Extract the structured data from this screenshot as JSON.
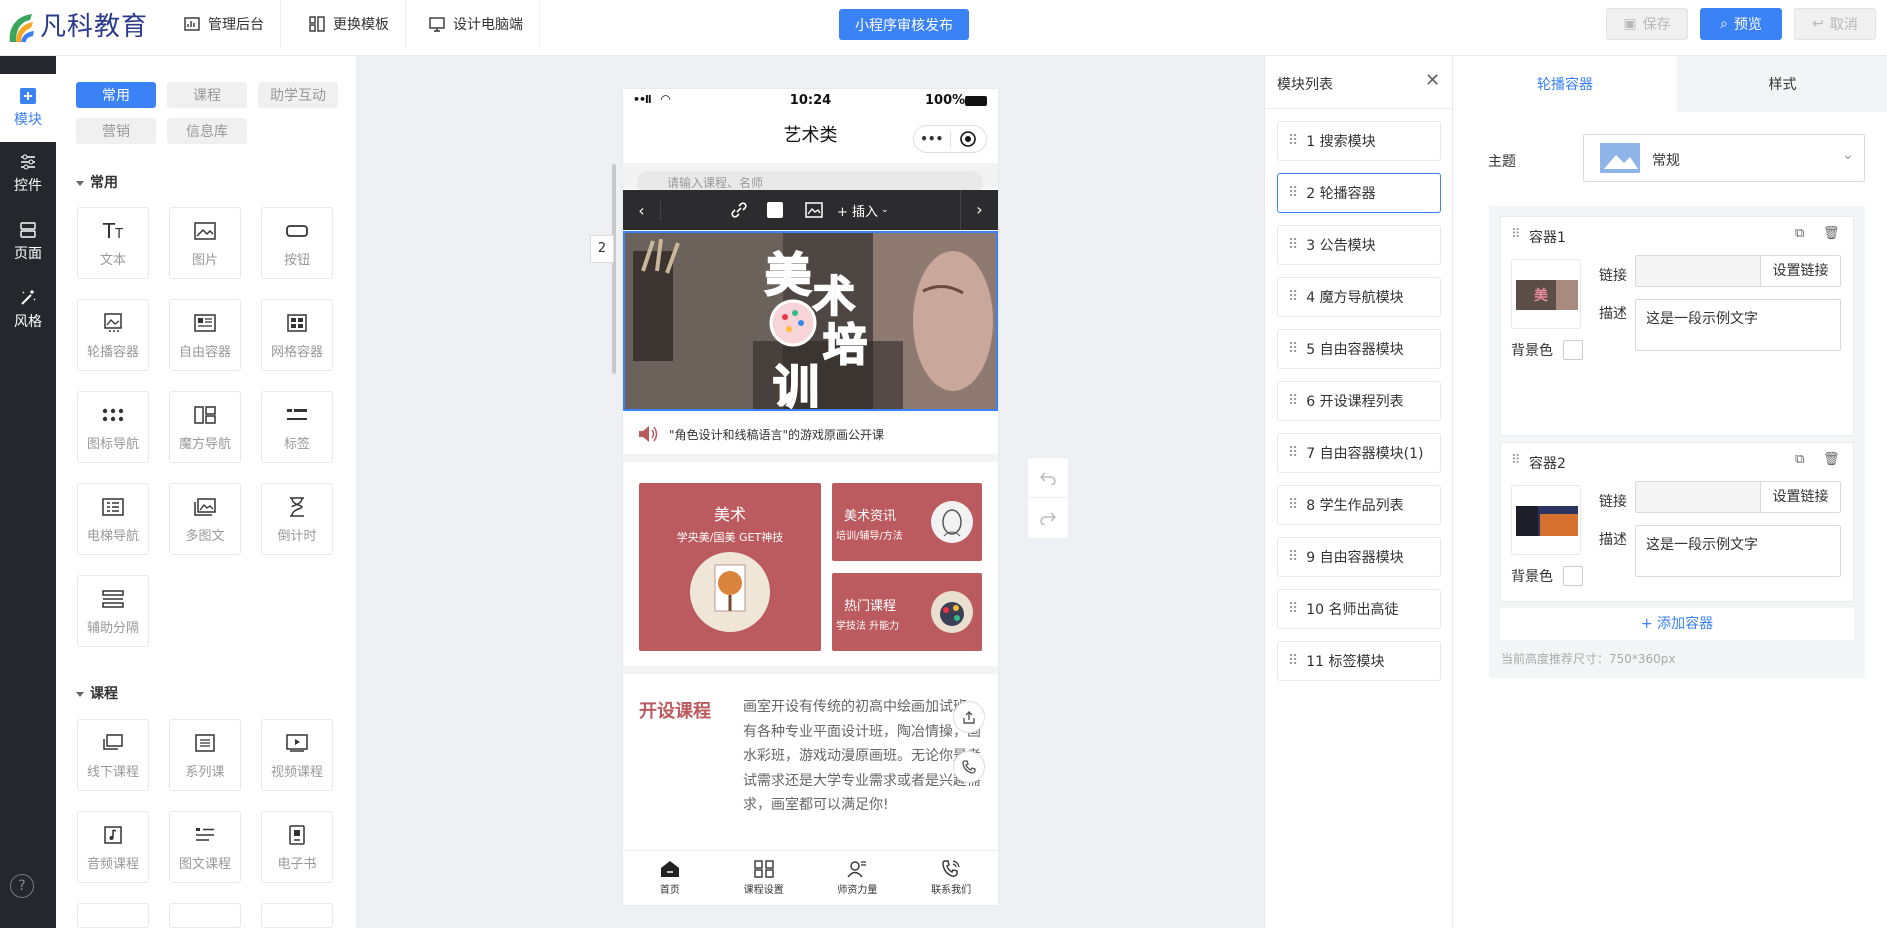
{
  "topbar": {
    "logo_text": "凡科教育",
    "nav": [
      "管理后台",
      "更换模板",
      "设计电脑端"
    ],
    "publish_label": "小程序审核发布",
    "save_label": "保存",
    "preview_label": "预览",
    "cancel_label": "取消"
  },
  "rail": {
    "items": [
      "模块",
      "控件",
      "页面",
      "风格"
    ],
    "help": "?"
  },
  "library": {
    "categories": [
      "常用",
      "课程",
      "助学互动",
      "营销",
      "信息库"
    ],
    "sections": [
      {
        "title": "常用",
        "items": [
          "文本",
          "图片",
          "按钮",
          "轮播容器",
          "自由容器",
          "网格容器",
          "图标导航",
          "魔方导航",
          "标签",
          "电梯导航",
          "多图文",
          "倒计时",
          "辅助分隔"
        ]
      },
      {
        "title": "课程",
        "items": [
          "线下课程",
          "系列课",
          "视频课程",
          "音频课程",
          "图文课程",
          "电子书"
        ]
      }
    ]
  },
  "phone": {
    "status_signal": "••ll",
    "time": "10:24",
    "battery": "100%",
    "title": "艺术类",
    "capsule_more": "•••",
    "search_placeholder": "请输入课程、名师",
    "editor": {
      "insert_label": "+ 插入",
      "badge": "2"
    },
    "banner_text": [
      "美",
      "术",
      "培",
      "训"
    ],
    "notice": "\"角色设计和线稿语言\"的游戏原画公开课",
    "cards": [
      {
        "title": "美术",
        "subtitle": "学央美/国美 GET神技"
      },
      {
        "title": "美术资讯",
        "subtitle": "培训/辅导/方法"
      },
      {
        "title": "热门课程",
        "subtitle": "学技法 升能力"
      }
    ],
    "open_course_title": "开设课程",
    "open_course_text": "画室开设有传统的初高中绘画加试班、有各种专业平面设计班，陶冶情操，画水彩班，游戏动漫原画班。无论你是考试需求还是大学专业需求或者是兴趣需求，画室都可以满足你!",
    "tabs": [
      "首页",
      "课程设置",
      "师资力量",
      "联系我们"
    ]
  },
  "module_list": {
    "title": "模块列表",
    "items": [
      "1 搜索模块",
      "2 轮播容器",
      "3 公告模块",
      "4 魔方导航模块",
      "5 自由容器模块",
      "6 开设课程列表",
      "7 自由容器模块(1)",
      "8 学生作品列表",
      "9 自由容器模块",
      "10 名师出高徒",
      "11 标签模块"
    ],
    "selected": "2 轮播容器"
  },
  "properties": {
    "tabs": [
      "轮播容器",
      "样式"
    ],
    "theme_label": "主题",
    "theme_value": "常规",
    "containers": [
      {
        "name": "容器1",
        "link_label": "链接",
        "link_button": "设置链接",
        "desc_label": "描述",
        "desc_value": "这是一段示例文字",
        "bg_label": "背景色"
      },
      {
        "name": "容器2",
        "link_label": "链接",
        "link_button": "设置链接",
        "desc_label": "描述",
        "desc_value": "这是一段示例文字",
        "bg_label": "背景色"
      }
    ],
    "add_container": "+ 添加容器",
    "size_hint": "当前高度推荐尺寸：750*360px"
  },
  "colors": {
    "accent": "#3b82f6",
    "brand_red": "#bb5a5f",
    "rail_bg": "#25272c"
  }
}
